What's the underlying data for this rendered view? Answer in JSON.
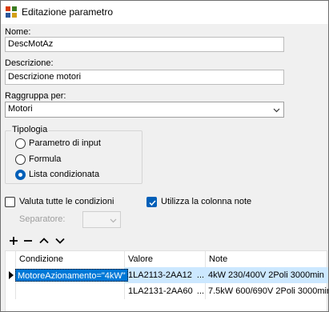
{
  "window": {
    "title": "Editazione parametro"
  },
  "nome": {
    "label": "Nome:",
    "value": "DescMotAz"
  },
  "descrizione": {
    "label": "Descrizione:",
    "value": "Descrizione motori"
  },
  "raggruppa": {
    "label": "Raggruppa per:",
    "value": "Motori"
  },
  "tipologia": {
    "title": "Tipologia",
    "options": [
      "Parametro di input",
      "Formula",
      "Lista condizionata"
    ],
    "selected": "Lista condizionata"
  },
  "valuta_tutte": {
    "label": "Valuta tutte le condizioni",
    "checked": false
  },
  "utilizza_note": {
    "label": "Utilizza la colonna note",
    "checked": true
  },
  "separatore": {
    "label": "Separatore:",
    "value": ""
  },
  "toolbar": {
    "icons": [
      "add-icon",
      "remove-icon",
      "move-up-icon",
      "move-down-icon"
    ]
  },
  "grid": {
    "columns": [
      "Condizione",
      "Valore",
      "Note"
    ],
    "rows": [
      {
        "condizione": "MotoreAzionamento=\"4kW\"",
        "valore": "1LA2113-2AA12",
        "ellipsis": "...",
        "note": "4kW 230/400V 2Poli 3000min"
      },
      {
        "condizione": "",
        "valore": "1LA2131-2AA60",
        "ellipsis": "...",
        "note": "7.5kW 600/690V 2Poli 3000min"
      }
    ]
  },
  "colors": {
    "accent": "#005fb8",
    "row_selected": "#cce8ff",
    "cell_selected": "#0078d7"
  }
}
